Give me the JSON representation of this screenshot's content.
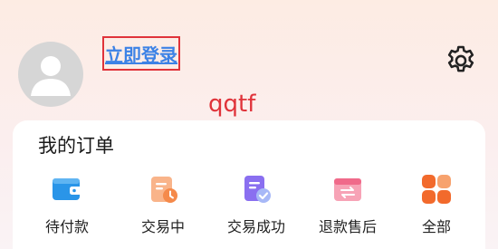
{
  "header": {
    "login_label": "立即登录",
    "annotation_text": "qqtf"
  },
  "icons": {
    "avatar": "default-user-avatar",
    "settings": "gear-icon"
  },
  "orders": {
    "title": "我的订单",
    "items": [
      {
        "label": "待付款",
        "icon": "wallet-icon",
        "color": "#2a95e8"
      },
      {
        "label": "交易中",
        "icon": "clipboard-clock-icon",
        "color": "#f58a4b"
      },
      {
        "label": "交易成功",
        "icon": "document-check-icon",
        "color": "#7b61e6"
      },
      {
        "label": "退款售后",
        "icon": "refund-exchange-icon",
        "color": "#f06a8a"
      },
      {
        "label": "全部",
        "icon": "grid-all-icon",
        "color": "#f26a2c"
      }
    ]
  },
  "colors": {
    "login_text": "#3c82e6",
    "highlight_border": "#e0333a",
    "annotation": "#e0333a"
  }
}
